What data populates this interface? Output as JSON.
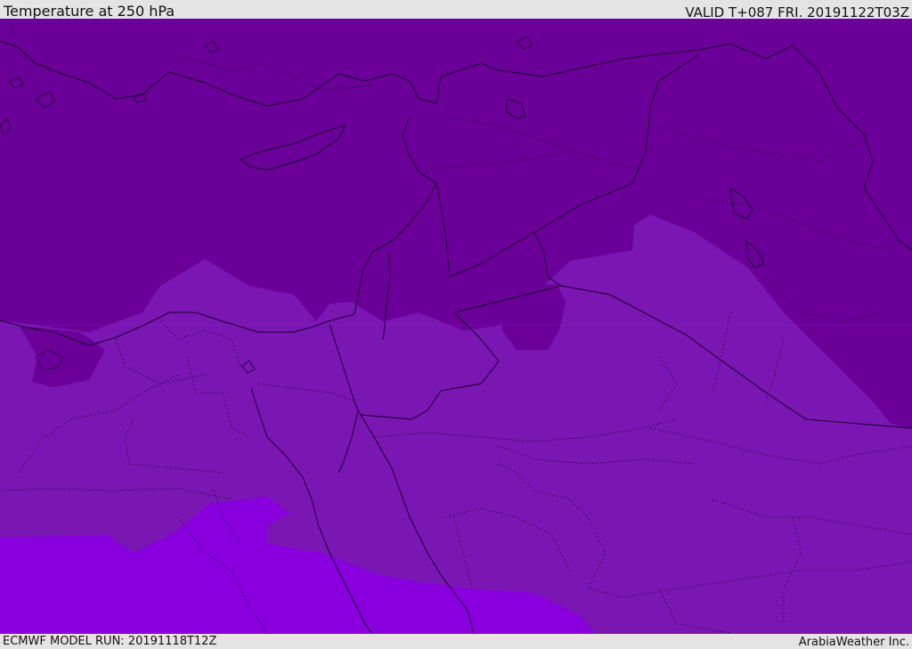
{
  "header": {
    "title": "Temperature at 250 hPa",
    "valid": "VALID T+087 FRI. 20191122T03Z"
  },
  "footer": {
    "model_run": "ECMWF MODEL RUN: 20191118T12Z",
    "credit": "ArabiaWeather Inc."
  },
  "map": {
    "variable": "temperature",
    "pressure_level": "250 hPa",
    "color_bands": [
      "#6a0098",
      "#7a16b2",
      "#8700dd"
    ],
    "boundary_color": "#1a0030"
  }
}
